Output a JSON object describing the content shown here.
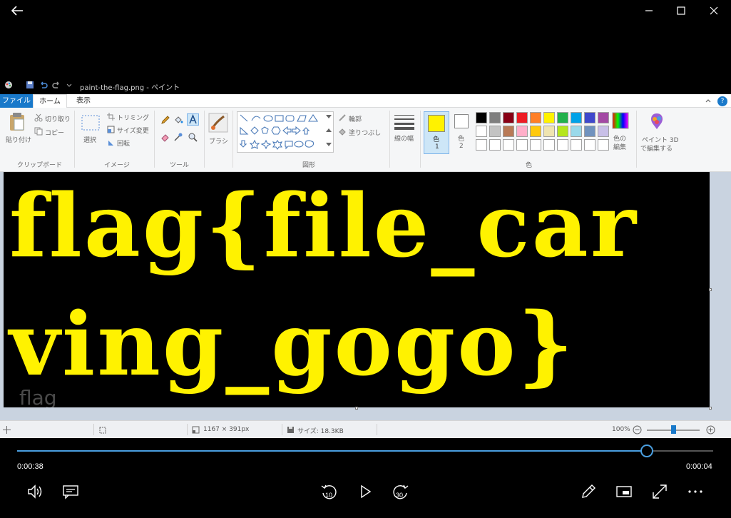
{
  "window": {
    "back_icon": "arrow-left-icon",
    "minimize_icon": "minimize-icon",
    "maximize_icon": "maximize-icon",
    "close_icon": "close-icon"
  },
  "paint": {
    "title": "paint-the-flag.png - ペイント",
    "tabs": {
      "file": "ファイル",
      "home": "ホーム",
      "view": "表示"
    },
    "help": "?",
    "clipboard": {
      "paste": "貼り付け",
      "cut": "切り取り",
      "copy": "コピー",
      "label": "クリップボード"
    },
    "image": {
      "select": "選択",
      "crop": "トリミング",
      "resize": "サイズ変更",
      "rotate": "回転",
      "label": "イメージ"
    },
    "tools": {
      "label": "ツール"
    },
    "brush": {
      "label": "ブラシ"
    },
    "shapes": {
      "outline": "輪郭",
      "fill": "塗りつぶし",
      "label": "図形"
    },
    "size": {
      "label": "線の幅"
    },
    "colors": {
      "color1": "色",
      "color1_num": "1",
      "color2": "色",
      "color2_num": "2",
      "edit": "色の\n編集",
      "edit_line1": "色の",
      "edit_line2": "編集",
      "label": "色",
      "palette_row1": [
        "#000000",
        "#7f7f7f",
        "#880015",
        "#ed1c24",
        "#ff7f27",
        "#fff200",
        "#22b14c",
        "#00a2e8",
        "#3f48cc",
        "#a349a4"
      ],
      "palette_row2": [
        "#ffffff",
        "#c3c3c3",
        "#b97a57",
        "#ffaec9",
        "#ffc90e",
        "#efe4b0",
        "#b5e61d",
        "#99d9ea",
        "#7092be",
        "#c8bfe7"
      ],
      "selected_color1": "#fff200",
      "selected_color2": "#ffffff"
    },
    "paint3d": {
      "line1": "ペイント 3D",
      "line2": "で編集する"
    },
    "canvas": {
      "line1": "flag{file_car",
      "line2": "ving_gogo}",
      "watermark": "flag",
      "text_color": "#fff200",
      "background": "#000000"
    },
    "status": {
      "dimensions": "1167 × 391px",
      "size": "サイズ: 18.3KB",
      "zoom": "100%"
    }
  },
  "player": {
    "elapsed": "0:00:38",
    "remaining": "0:00:04",
    "progress": 0.905,
    "skip_back": "10",
    "skip_forward": "30"
  }
}
